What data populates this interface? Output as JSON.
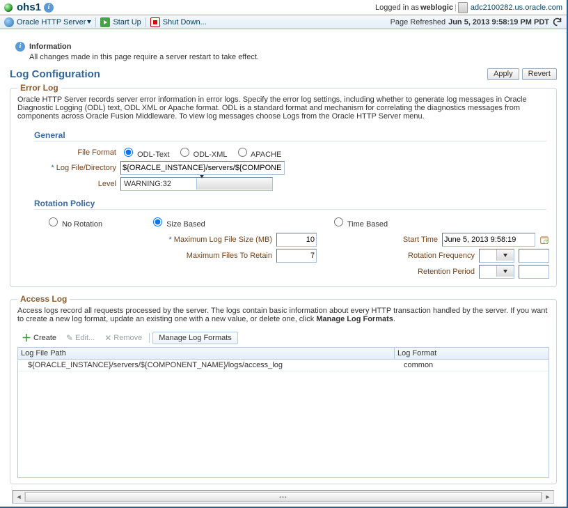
{
  "topbar": {
    "server_name": "ohs1",
    "login_prefix": "Logged in as ",
    "login_user": "weblogic",
    "host": "adc2100282.us.oracle.com"
  },
  "menubar": {
    "server_menu": "Oracle HTTP Server",
    "startup": "Start Up",
    "shutdown": "Shut Down...",
    "refreshed_prefix": "Page Refreshed ",
    "refreshed_time": "Jun 5, 2013 9:58:19 PM PDT"
  },
  "info": {
    "heading": "Information",
    "text": "All changes made in this page require a server restart to take effect."
  },
  "page": {
    "title": "Log Configuration",
    "apply": "Apply",
    "revert": "Revert"
  },
  "errorlog": {
    "legend": "Error Log",
    "description": "Oracle HTTP Server records server error information in error logs. Specify the error log settings, including whether to generate log messages in Oracle Diagnostic Logging (ODL) text, ODL XML or Apache format. ODL is a standard format and mechanism for correlating the diagnostics messages from components across Oracle Fusion Middleware. To view log messages choose Logs from the Oracle HTTP Server menu.",
    "general": "General",
    "file_format_label": "File Format",
    "fmt_odl_text": "ODL-Text",
    "fmt_odl_xml": "ODL-XML",
    "fmt_apache": "APACHE",
    "logdir_label": "Log File/Directory",
    "logdir_value": "${ORACLE_INSTANCE}/servers/${COMPONE",
    "level_label": "Level",
    "level_value": "WARNING:32",
    "rotation_policy": "Rotation Policy",
    "no_rotation": "No Rotation",
    "size_based": "Size Based",
    "time_based": "Time Based",
    "max_size_label": "Maximum Log File Size (MB)",
    "max_size_value": "10",
    "max_retain_label": "Maximum Files To Retain",
    "max_retain_value": "7",
    "start_time_label": "Start Time",
    "start_time_value": "June 5, 2013 9:58:19 ",
    "rotation_freq_label": "Rotation Frequency",
    "retention_period_label": "Retention Period"
  },
  "accesslog": {
    "legend": "Access Log",
    "description_1": "Access logs record all requests processed by the server. The logs contain basic information about every HTTP transaction handled by the server. If you want to create a new log format, update an existing one with a new value, or delete one, click ",
    "description_bold": "Manage Log Formats",
    "description_2": ".",
    "create": "Create",
    "edit": "Edit...",
    "remove": "Remove",
    "manage": "Manage Log Formats",
    "col_path": "Log File Path",
    "col_format": "Log Format",
    "row_path": "${ORACLE_INSTANCE}/servers/${COMPONENT_NAME}/logs/access_log",
    "row_format": "common"
  }
}
